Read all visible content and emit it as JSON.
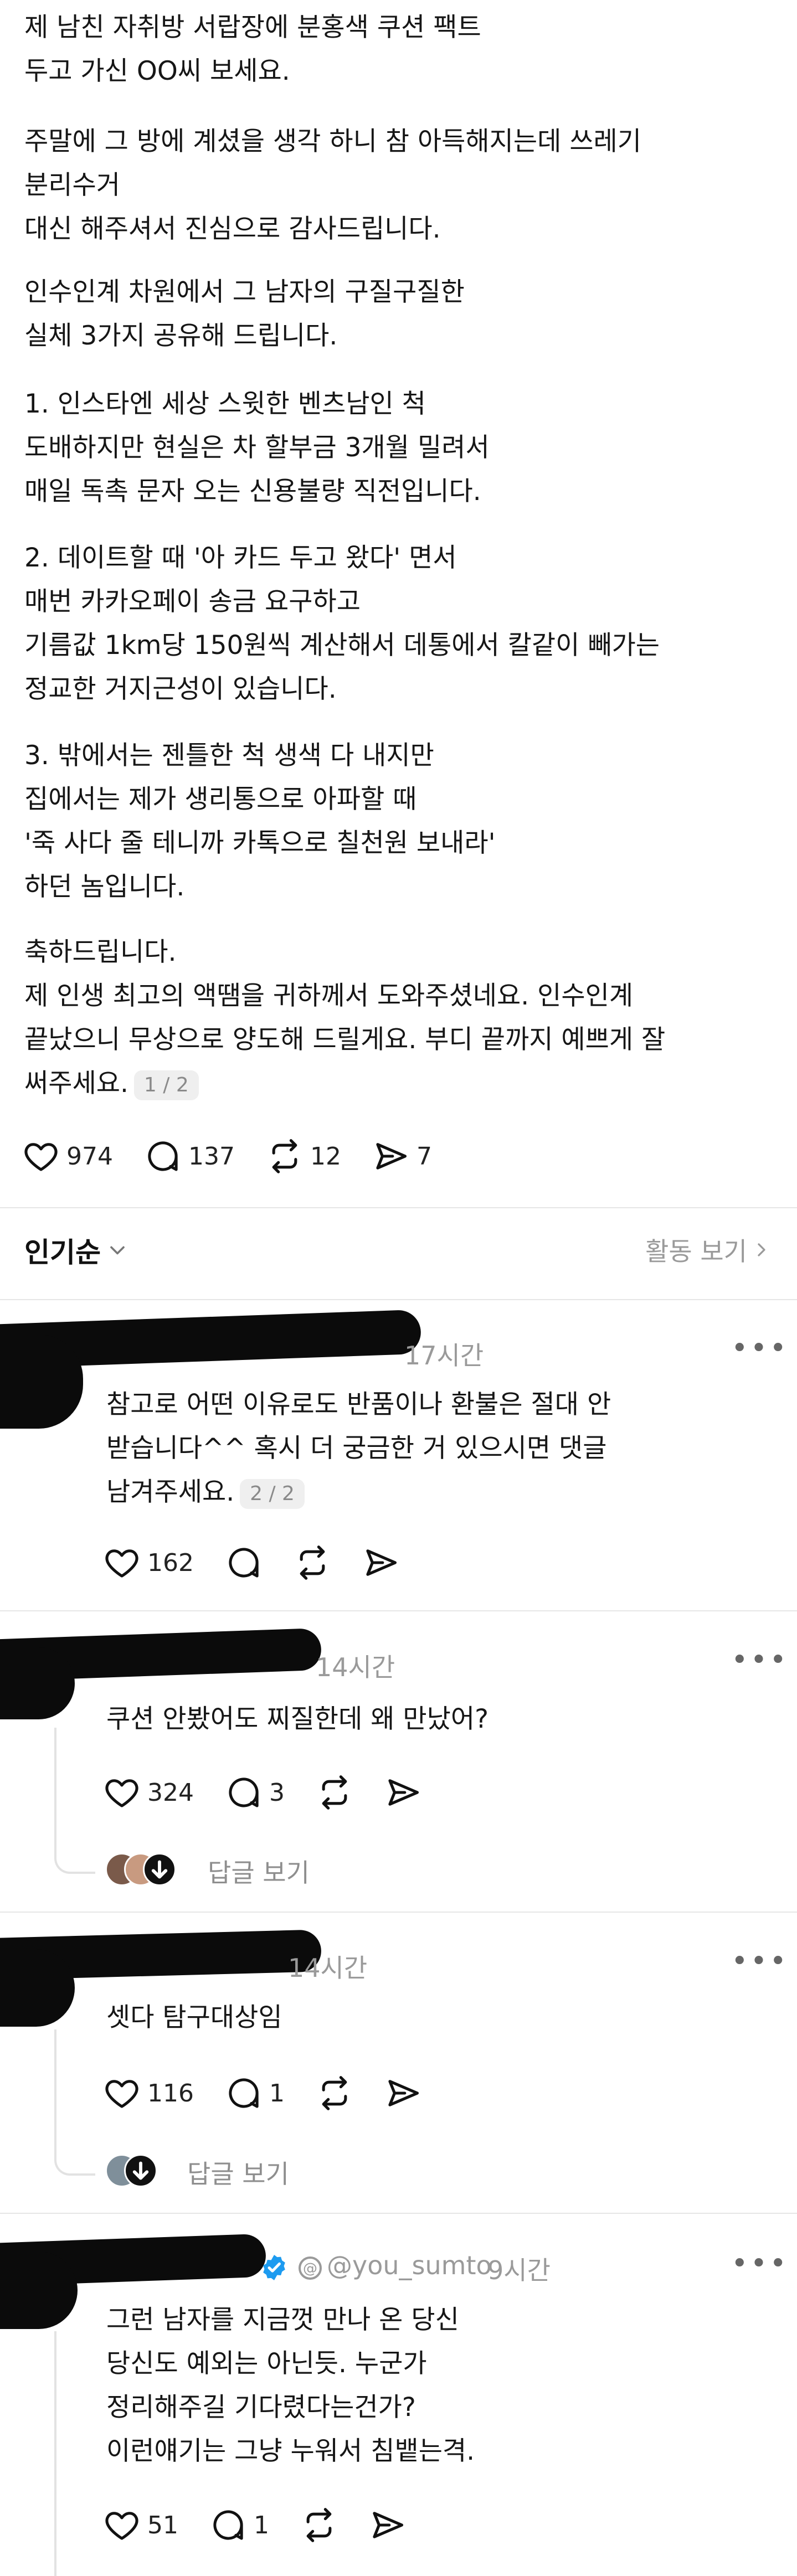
{
  "post": {
    "paragraphs": [
      "제 남친 자취방 서랍장에 분홍색 쿠션 팩트\n두고 가신 OO씨 보세요.",
      "주말에 그 방에 계셨을 생각 하니 참 아득해지는데 쓰레기\n분리수거\n대신 해주셔서 진심으로 감사드립니다.",
      "인수인계 차원에서 그 남자의 구질구질한\n실체 3가지 공유해 드립니다.",
      "1. 인스타엔 세상 스윗한 벤츠남인 척\n도배하지만 현실은 차 할부금 3개월 밀려서\n매일 독촉 문자 오는 신용불량 직전입니다.",
      "2. 데이트할 때 '아 카드 두고 왔다' 면서\n매번 카카오페이 송금 요구하고\n기름값 1km당 150원씩 계산해서 데통에서 칼같이 빼가는\n정교한 거지근성이 있습니다.",
      "3. 밖에서는 젠틀한 척 생색 다 내지만\n집에서는 제가 생리통으로 아파할 때\n'죽 사다 줄 테니까 카톡으로 칠천원 보내라'\n하던 놈입니다.",
      "축하드립니다.\n제 인생 최고의 액땜을 귀하께서 도와주셨네요. 인수인계\n끝났으니 무상으로 양도해 드릴게요. 부디 끝까지 예쁘게 잘\n써주세요."
    ],
    "page_badge": "1 / 2",
    "likes": "974",
    "comments": "137",
    "reposts": "12",
    "shares": "7"
  },
  "sort": {
    "label": "인기순",
    "activity_link": "활동 보기"
  },
  "comments": [
    {
      "time": "17시간",
      "text": "참고로 어떤 이유로도 반품이나 환불은 절대 안\n받습니다^^ 혹시 더 궁금한 거 있으시면 댓글\n남겨주세요.",
      "badge": "2 / 2",
      "likes": "162"
    },
    {
      "time": "14시간",
      "text": "쿠션 안봤어도 찌질한데 왜 만났어?",
      "likes": "324",
      "replies": "3",
      "view_replies": "답글 보기"
    },
    {
      "time": "14시간",
      "text": "셋다 탐구대상임",
      "likes": "116",
      "replies": "1",
      "view_replies": "답글 보기"
    },
    {
      "handle": "@you_sumto",
      "time": "9시간",
      "text": "그런 남자를 지금껏 만나 온 당신\n당신도 예외는 아닌듯. 누군가\n정리해주길 기다렸다는건가?\n이런얘기는 그냥 누워서 침뱉는격.",
      "likes": "51",
      "replies": "1"
    }
  ],
  "icons": {
    "like": "heart-icon",
    "comment": "speech-bubble-icon",
    "repost": "repost-icon",
    "share": "send-icon",
    "more": "more-dots-icon",
    "verified": "verified-badge-icon"
  },
  "colors": {
    "verified": "#1d9bf0",
    "muted": "#9a9a9a"
  }
}
